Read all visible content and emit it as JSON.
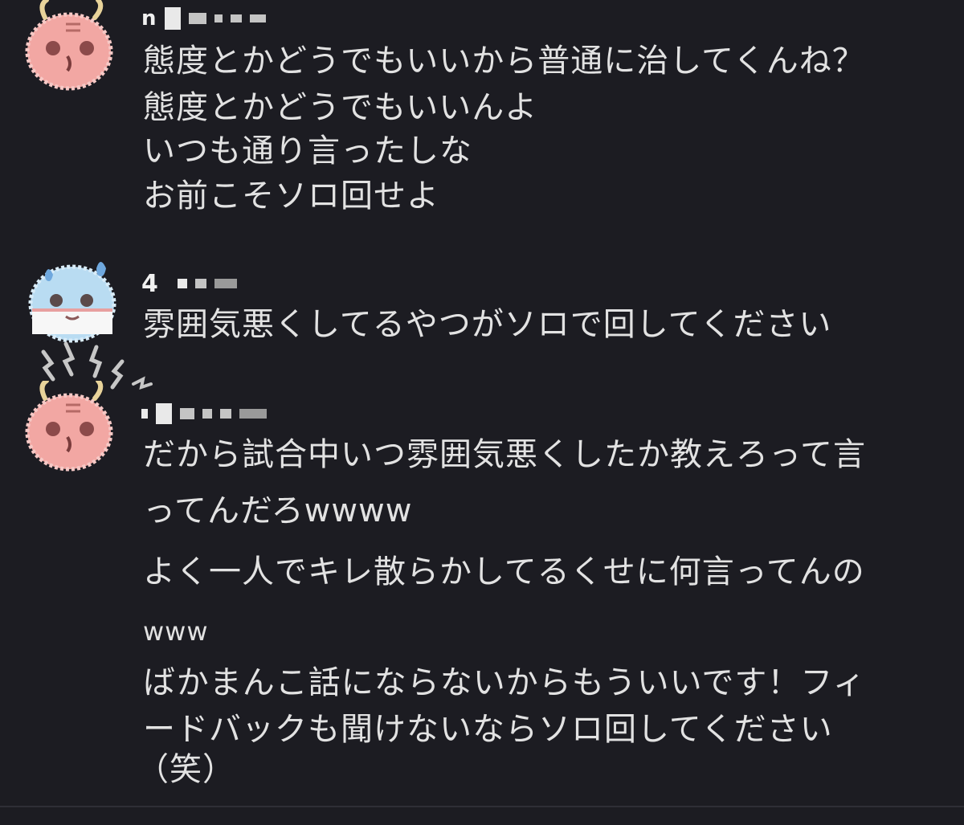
{
  "messages": [
    {
      "author_name": "n",
      "avatar_icon": "red-oni-mascot-icon",
      "lines": [
        "態度とかどうでもいいから普通に治してくんね？",
        "態度とかどうでもいいんよ",
        "いつも通り言ったしな",
        "お前こそソロ回せよ"
      ]
    },
    {
      "author_name": "4",
      "avatar_icon": "blue-sweat-mascot-icon",
      "lines": [
        "雰囲気悪くしてるやつがソロで回してください"
      ]
    },
    {
      "author_name": "",
      "avatar_icon": "red-oni-mascot-icon",
      "lines": [
        "だから試合中いつ雰囲気悪くしたか教えろって言",
        "ってんだろwwww",
        "よく一人でキレ散らかしてるくせに何言ってんの",
        "www",
        "ばかまんこ話にならないからもういいです！フィ",
        "ードバックも聞けないならソロ回してください",
        "（笑）"
      ]
    }
  ],
  "colors": {
    "background": "#1c1c22",
    "text": "#e2e2e2",
    "oni_body": "#f2a7a3",
    "blue_body": "#b9dcf2"
  }
}
